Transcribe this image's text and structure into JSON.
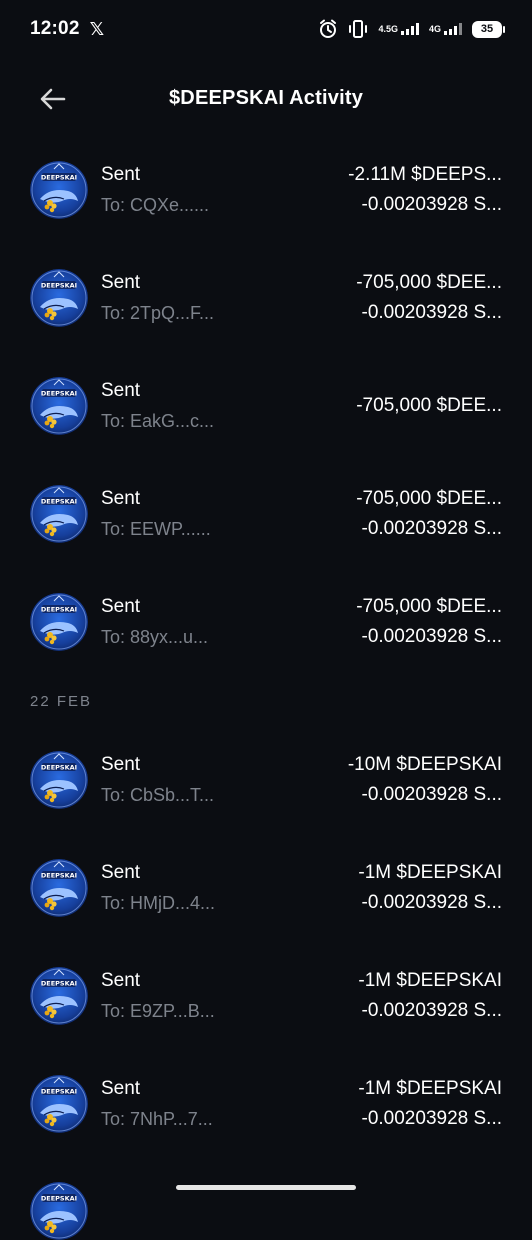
{
  "status_bar": {
    "time": "12:02",
    "x_icon": "x-logo-icon",
    "net1": "4.5G",
    "net2": "4G",
    "battery": "35"
  },
  "header": {
    "title": "$DEEPSKAI Activity",
    "back_icon": "arrow-left-icon"
  },
  "date_separator": "22 FEB",
  "transactions_recent": [
    {
      "title": "Sent",
      "to": "To:  CQXe......",
      "amount1": "-2.11M $DEEPS...",
      "amount2": "-0.00203928 S..."
    },
    {
      "title": "Sent",
      "to": "To:  2TpQ...F...",
      "amount1": "-705,000 $DEE...",
      "amount2": "-0.00203928 S..."
    },
    {
      "title": "Sent",
      "to": "To:  EakG...c...",
      "amount1": "-705,000 $DEE...",
      "amount2": ""
    },
    {
      "title": "Sent",
      "to": "To:  EEWP......",
      "amount1": "-705,000 $DEE...",
      "amount2": "-0.00203928 S..."
    },
    {
      "title": "Sent",
      "to": "To:  88yx...u...",
      "amount1": "-705,000 $DEE...",
      "amount2": "-0.00203928 S..."
    }
  ],
  "transactions_feb22": [
    {
      "title": "Sent",
      "to": "To:  CbSb...T...",
      "amount1": "-10M $DEEPSKAI",
      "amount2": "-0.00203928 S..."
    },
    {
      "title": "Sent",
      "to": "To:  HMjD...4...",
      "amount1": "-1M $DEEPSKAI",
      "amount2": "-0.00203928 S..."
    },
    {
      "title": "Sent",
      "to": "To:  E9ZP...B...",
      "amount1": "-1M $DEEPSKAI",
      "amount2": "-0.00203928 S..."
    },
    {
      "title": "Sent",
      "to": "To:  7NhP...7...",
      "amount1": "-1M $DEEPSKAI",
      "amount2": "-0.00203928 S..."
    }
  ],
  "avatar": {
    "icon": "deepskai-token-icon",
    "label": "DEEPSKAI"
  },
  "colors": {
    "background": "#0b0d12",
    "muted": "#7e838c",
    "avatar_blue": "#1f4fb8"
  }
}
